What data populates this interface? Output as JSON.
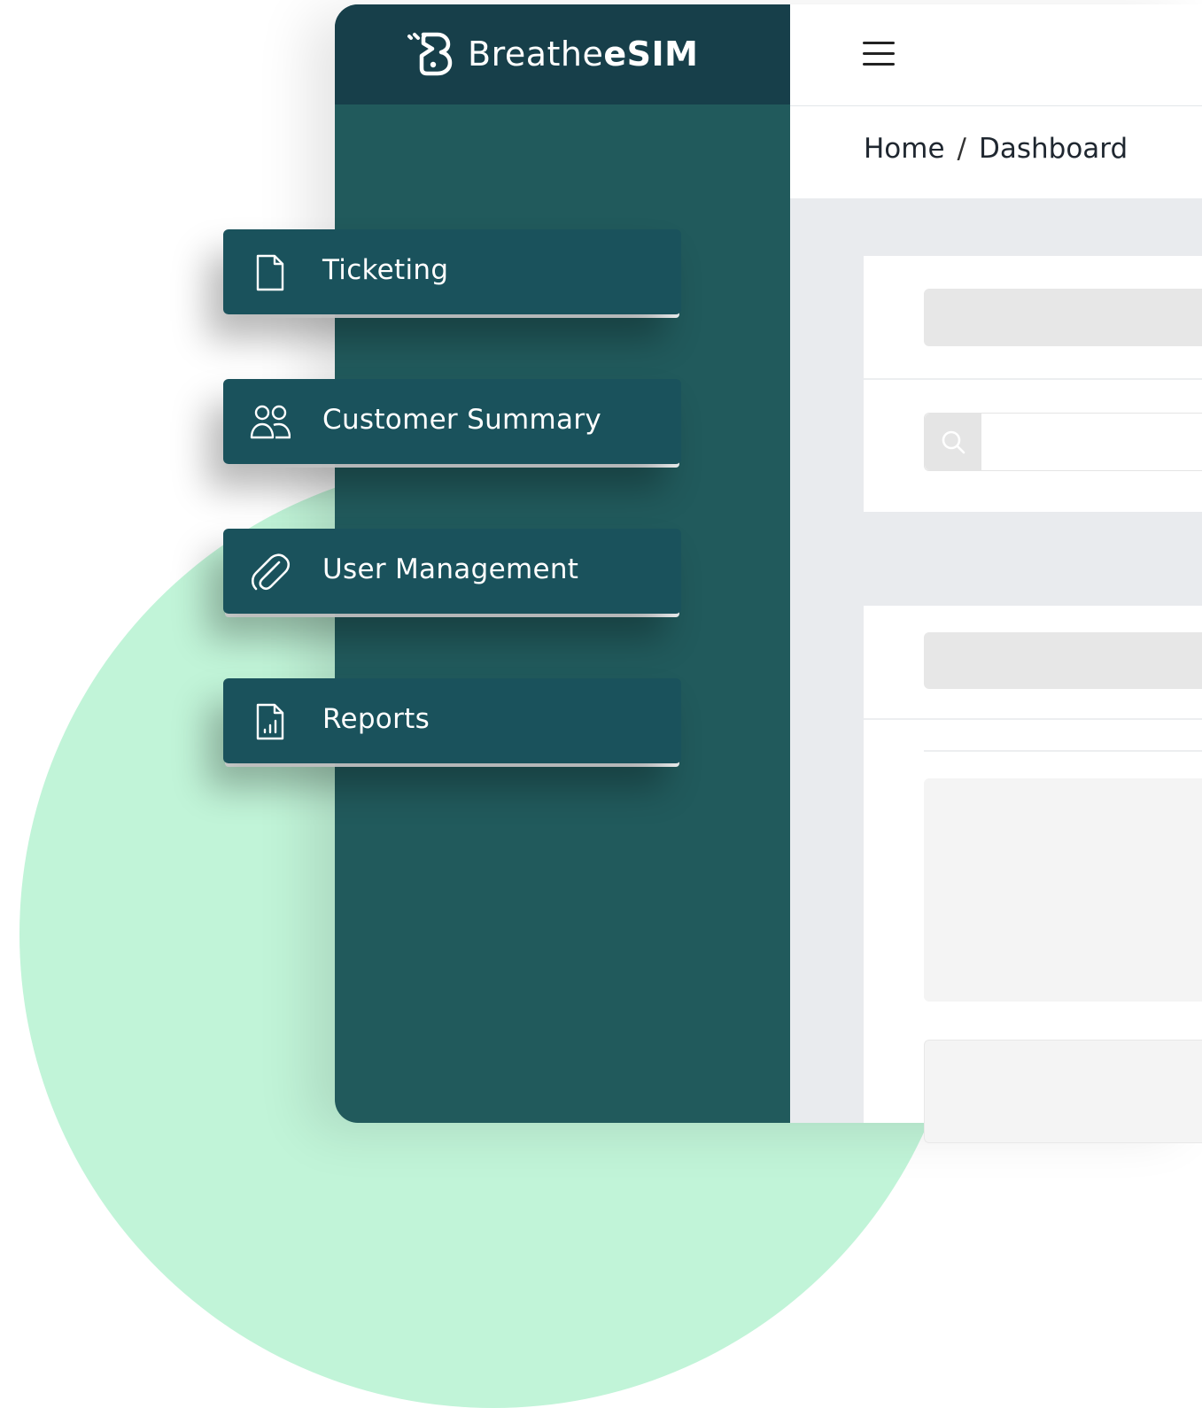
{
  "brand": {
    "name_prefix": "Breathe",
    "name_suffix": "eSIM",
    "logo_icon": "breathesim-logo-icon"
  },
  "topbar": {
    "menu_icon": "hamburger-icon"
  },
  "breadcrumb": {
    "home": "Home",
    "separator": "/",
    "current": "Dashboard"
  },
  "search": {
    "icon": "search-icon",
    "placeholder": ""
  },
  "sidebar": {
    "items": [
      {
        "label": "Ticketing",
        "icon": "document-icon"
      },
      {
        "label": "Customer Summary",
        "icon": "users-icon"
      },
      {
        "label": "User Management",
        "icon": "paperclip-icon"
      },
      {
        "label": "Reports",
        "icon": "report-chart-icon"
      }
    ]
  },
  "colors": {
    "sidebar": "#215a5c",
    "sidebar_header": "#173f4a",
    "nav_item": "#1a525c",
    "background_circle": "#c1f4d8",
    "content_bg": "#e9ebee"
  }
}
